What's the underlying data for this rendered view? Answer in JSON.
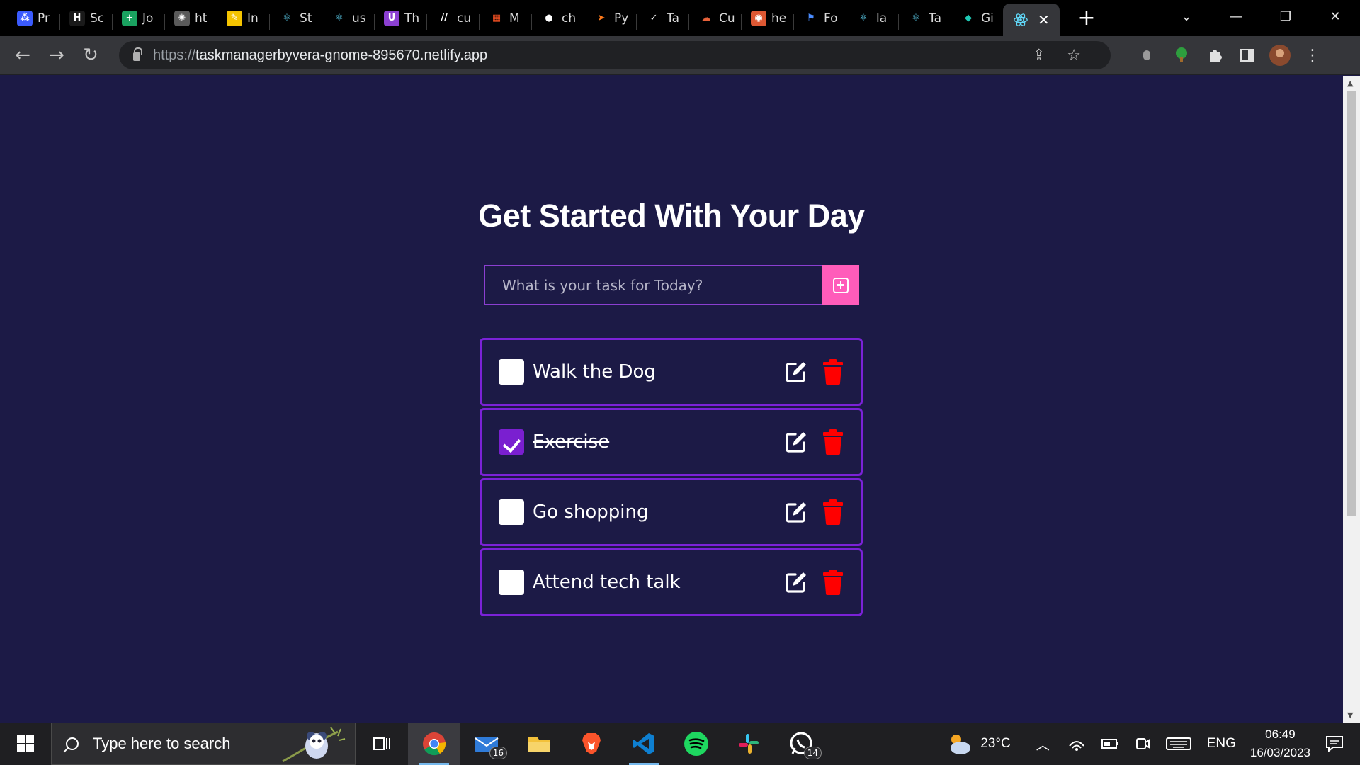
{
  "browser": {
    "tabs": [
      {
        "title": "Pr",
        "favicon": "grid-icon",
        "color": "#3b5bfd"
      },
      {
        "title": "Sc",
        "favicon": "hh-icon",
        "color": "#1a1a1a"
      },
      {
        "title": "Jo",
        "favicon": "plus-square-icon",
        "color": "#1aa260"
      },
      {
        "title": "ht",
        "favicon": "openai-icon",
        "color": "#5a5a5a"
      },
      {
        "title": "In",
        "favicon": "pencil-icon",
        "color": "#f5c400"
      },
      {
        "title": "St",
        "favicon": "react-icon",
        "color": "#000"
      },
      {
        "title": "us",
        "favicon": "react-icon",
        "color": "#000"
      },
      {
        "title": "Th",
        "favicon": "u-icon",
        "color": "#8b3fd1"
      },
      {
        "title": "cu",
        "favicon": "slashes-icon",
        "color": "#000"
      },
      {
        "title": "M",
        "favicon": "microsoft-icon",
        "color": "#000"
      },
      {
        "title": "ch",
        "favicon": "github-icon",
        "color": "#000"
      },
      {
        "title": "Py",
        "favicon": "arrow-icon",
        "color": "#000"
      },
      {
        "title": "Ta",
        "favicon": "check-icon",
        "color": "#000"
      },
      {
        "title": "Cu",
        "favicon": "cloud-icon",
        "color": "#000"
      },
      {
        "title": "he",
        "favicon": "duck-icon",
        "color": "#de5833"
      },
      {
        "title": "Fo",
        "favicon": "flag-icon",
        "color": "#000"
      },
      {
        "title": "la",
        "favicon": "react-icon",
        "color": "#000"
      },
      {
        "title": "Ta",
        "favicon": "react-icon",
        "color": "#000"
      },
      {
        "title": "Gi",
        "favicon": "diamond-icon",
        "color": "#000"
      }
    ],
    "active_tab": {
      "favicon": "react-icon",
      "close_label": "✕"
    },
    "new_tab_label": "+",
    "url_scheme": "https://",
    "url_host": "taskmanagerbyvera-gnome-895670.netlify.app"
  },
  "app": {
    "heading": "Get Started With Your Day",
    "input_placeholder": "What is your task for Today?",
    "tasks": [
      {
        "label": "Walk the Dog",
        "done": false
      },
      {
        "label": "Exercise",
        "done": true
      },
      {
        "label": "Go shopping",
        "done": false
      },
      {
        "label": "Attend tech talk",
        "done": false
      }
    ],
    "colors": {
      "background": "#1c1a46",
      "border": "#7b22d8",
      "add_button": "#ff5cba",
      "delete": "#ff0000"
    }
  },
  "taskbar": {
    "search_placeholder": "Type here to search",
    "mail_badge": "16",
    "whatsapp_badge": "14",
    "weather": "23°C",
    "language": "ENG",
    "time": "06:49",
    "date": "16/03/2023"
  }
}
